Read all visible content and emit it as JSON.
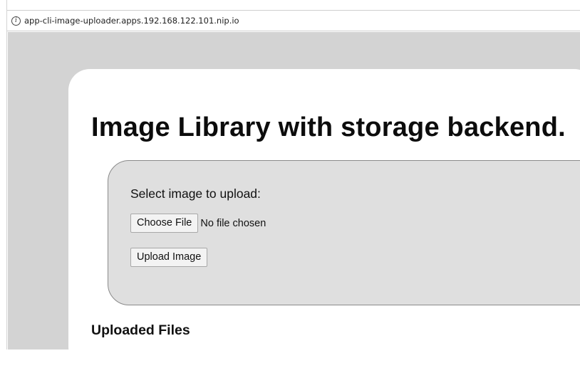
{
  "browser": {
    "url": "app-cli-image-uploader.apps.192.168.122.101.nip.io",
    "info_icon": "info-icon"
  },
  "page": {
    "title": "Image Library with storage backend.",
    "upload_form": {
      "select_label": "Select image to upload:",
      "choose_file_label": "Choose File",
      "file_status": "No file chosen",
      "upload_button_label": "Upload Image"
    },
    "uploaded_files_heading": "Uploaded Files"
  },
  "colors": {
    "page_background": "#d3d3d3",
    "container_background": "#ffffff",
    "form_background": "#dfdfdf",
    "form_border": "#8a8a8a"
  }
}
